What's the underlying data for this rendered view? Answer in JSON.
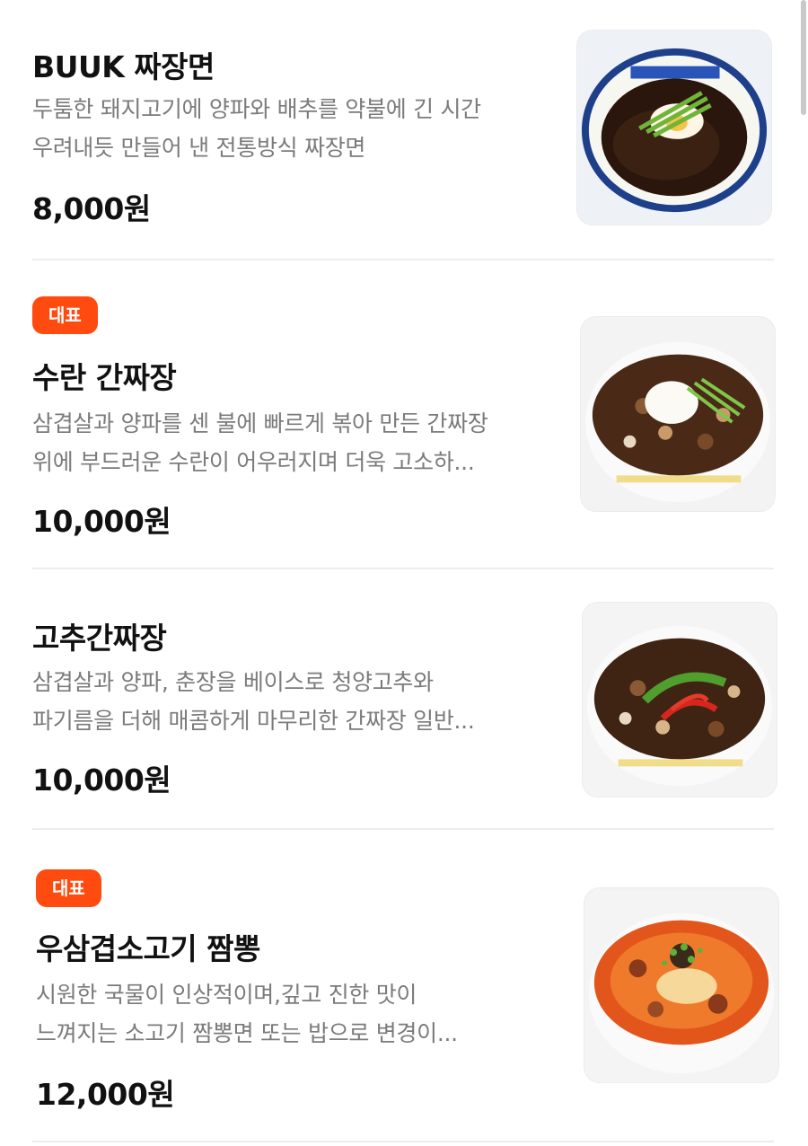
{
  "menu": {
    "items": [
      {
        "badge": "",
        "name": "BUUK 짜장면",
        "description_lines": [
          "두툼한 돼지고기에 양파와 배추를 약불에 긴 시간",
          "우려내듯 만들어 낸 전통방식 짜장면"
        ],
        "price": "8,000원",
        "image_icon": "jajangmyeon-bowl-image"
      },
      {
        "badge": "대표",
        "name": "수란 간짜장",
        "description_lines": [
          "삼겹살과 양파를 센 불에 빠르게 볶아 만든 간짜장",
          "위에 부드러운 수란이 어우러지며 더욱 고소하..."
        ],
        "price": "10,000원",
        "image_icon": "ganjjajang-poached-egg-image"
      },
      {
        "badge": "",
        "name": "고추간짜장",
        "description_lines": [
          "삼겹살과 양파, 춘장을 베이스로 청양고추와",
          "파기름을 더해 매콤하게 마무리한 간짜장 일반..."
        ],
        "price": "10,000원",
        "image_icon": "pepper-ganjjajang-image"
      },
      {
        "badge": "대표",
        "name": "우삼겹소고기 짬뽕",
        "description_lines": [
          "시원한 국물이 인상적이며,깊고 진한 맛이",
          "느껴지는 소고기 짬뽕면 또는 밥으로 변경이..."
        ],
        "price": "12,000원",
        "image_icon": "beef-jjamppong-image"
      }
    ]
  },
  "colors": {
    "badge": "#ff4a10",
    "title": "#111111",
    "description": "#7b7b7b",
    "divider": "#ededed"
  }
}
